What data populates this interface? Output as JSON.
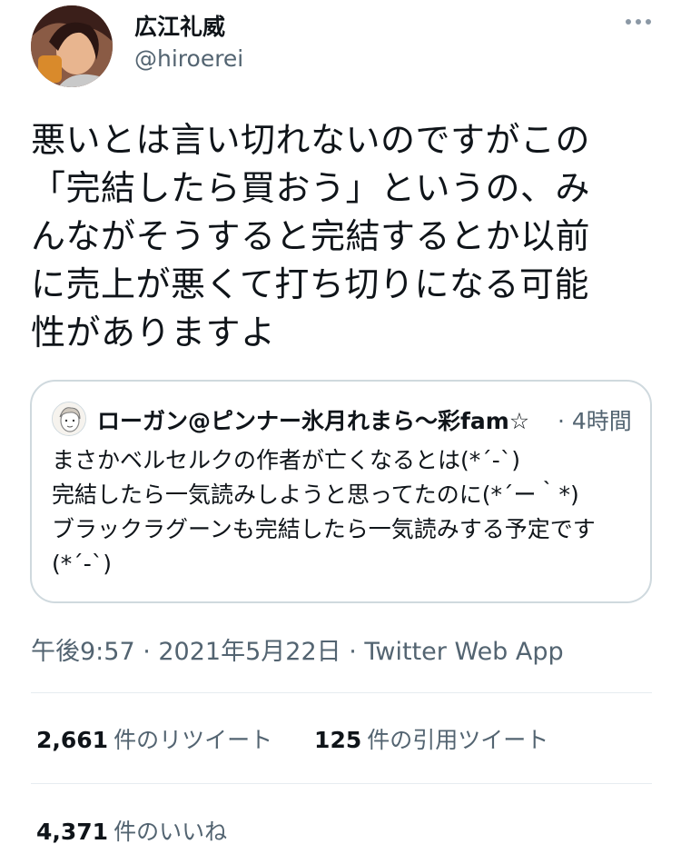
{
  "tweet": {
    "display_name": "広江礼威",
    "handle": "@hiroerei",
    "text": "悪いとは言い切れないのですがこの\n「完結したら買おう」というの、み\nんながそうすると完結するとか以前\nに売上が悪くて打ち切りになる可能\n性がありますよ",
    "timestamp": "午後9:57 · 2021年5月22日 · ",
    "source": "Twitter Web App"
  },
  "quote": {
    "display_name": "ローガン@ピンナー氷月れまら〜彩fam☆",
    "time": "· 4時間",
    "text": "まさかベルセルクの作者が亡くなるとは(*´-`)\n完結したら一気読みしようと思ってたのに(*´ー｀*)\nブラックラグーンも完結したら一気読みする予定です\n(*´-`)"
  },
  "stats": {
    "retweets_count": "2,661",
    "retweets_label": "件のリツイート",
    "quotes_count": "125",
    "quotes_label": "件の引用ツイート",
    "likes_count": "4,371",
    "likes_label": "件のいいね"
  },
  "icons": {
    "avatar": "user-avatar-anime",
    "quote_avatar": "quote-user-avatar",
    "more": "more-options-icon"
  }
}
